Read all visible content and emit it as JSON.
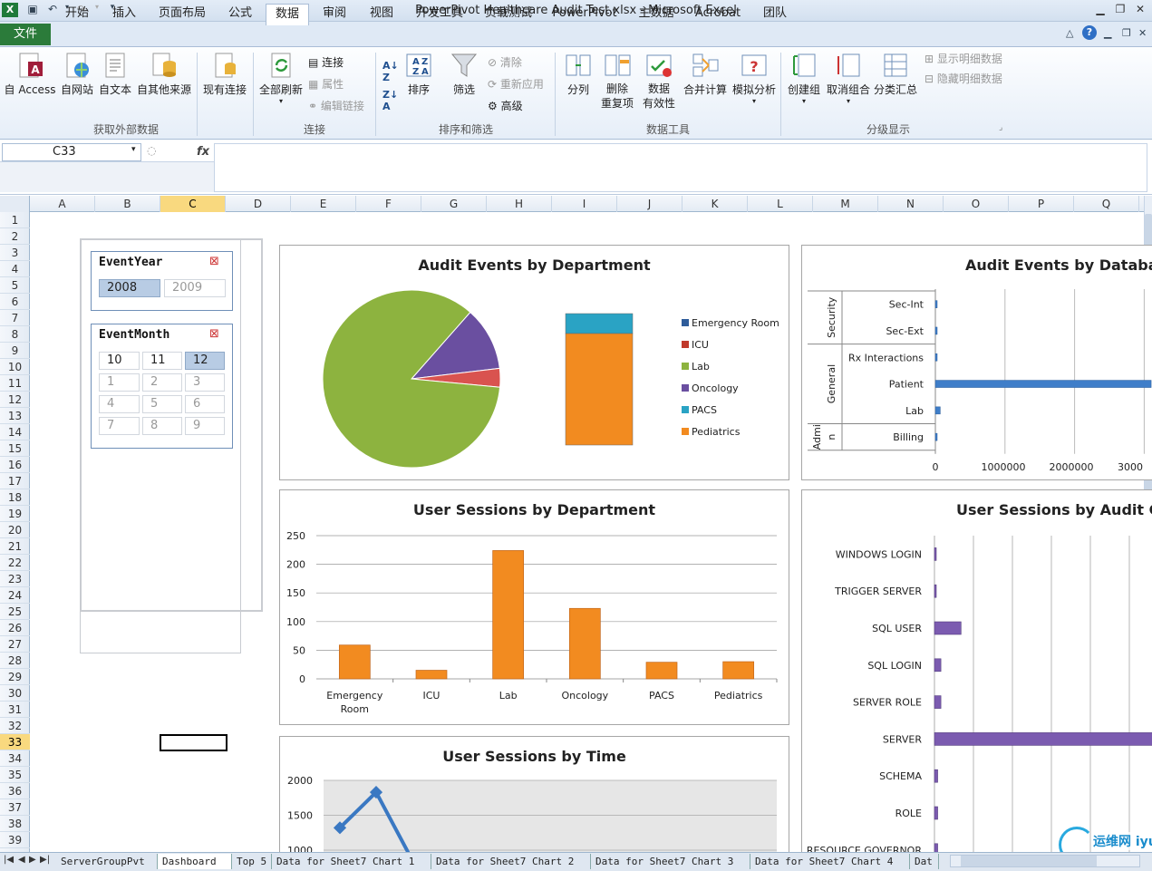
{
  "window": {
    "title": "PowerPivot Healthcare Audit Test.xlsx  -  Microsoft Excel"
  },
  "ribbon": {
    "file_tab": "文件",
    "tabs": [
      "开始",
      "插入",
      "页面布局",
      "公式",
      "数据",
      "审阅",
      "视图",
      "开发工具",
      "负载测试",
      "PowerPivot",
      "主数据",
      "Acrobat",
      "团队"
    ],
    "active_tab": "数据",
    "groups": {
      "external": {
        "label": "获取外部数据",
        "buttons": [
          "自 Access",
          "自网站",
          "自文本",
          "自其他来源",
          "现有连接"
        ]
      },
      "connections": {
        "label": "连接",
        "refresh": "全部刷新",
        "small": [
          "连接",
          "属性",
          "编辑链接"
        ]
      },
      "sort": {
        "label": "排序和筛选",
        "sort": "排序",
        "filter": "筛选",
        "small": [
          "清除",
          "重新应用",
          "高级"
        ]
      },
      "tools": {
        "label": "数据工具",
        "buttons": [
          "分列",
          "删除\n重复项",
          "数据\n有效性",
          "合并计算",
          "模拟分析"
        ],
        "remove_dup": [
          "删除",
          "重复项"
        ],
        "validation": [
          "数据",
          "有效性"
        ]
      },
      "outline": {
        "label": "分级显示",
        "buttons": [
          "创建组",
          "取消组合",
          "分类汇总"
        ],
        "small": [
          "显示明细数据",
          "隐藏明细数据"
        ]
      }
    }
  },
  "formula_bar": {
    "name_box": "C33",
    "fx": "fx",
    "value": ""
  },
  "grid": {
    "columns": [
      "A",
      "B",
      "C",
      "D",
      "E",
      "F",
      "G",
      "H",
      "I",
      "J",
      "K",
      "L",
      "M",
      "N",
      "O",
      "P",
      "Q"
    ],
    "selected_column": "C",
    "rows": [
      "1",
      "2",
      "3",
      "4",
      "5",
      "6",
      "7",
      "8",
      "9",
      "10",
      "11",
      "12",
      "13",
      "14",
      "15",
      "16",
      "17",
      "18",
      "19",
      "20",
      "21",
      "22",
      "23",
      "24",
      "25",
      "26",
      "27",
      "28",
      "29",
      "30",
      "31",
      "32",
      "33",
      "34",
      "35",
      "36",
      "37",
      "38",
      "39"
    ],
    "selected_row": "33"
  },
  "slicers": {
    "year": {
      "title": "EventYear",
      "items": [
        "2008",
        "2009"
      ],
      "selected": "2008"
    },
    "month": {
      "title": "EventMonth",
      "items": [
        "10",
        "11",
        "12",
        "1",
        "2",
        "3",
        "4",
        "5",
        "6",
        "7",
        "8",
        "9"
      ],
      "selected": "12"
    }
  },
  "sheet_tabs": [
    "ServerGroupPvt",
    "Dashboard",
    "Top 5",
    "Data for Sheet7 Chart 1",
    "Data for Sheet7 Chart 2",
    "Data for Sheet7 Chart 3",
    "Data for Sheet7 Chart 4",
    "Dat"
  ],
  "active_sheet": "Dashboard",
  "watermark": "运维网 iyunv.com",
  "chart_data": [
    {
      "type": "pie",
      "title": "Audit Events by Department",
      "legend": [
        "Emergency Room",
        "ICU",
        "Lab",
        "Oncology",
        "PACS",
        "Pediatrics"
      ],
      "colors": [
        "#2e5c9a",
        "#c0392b",
        "#8db33f",
        "#6a4fa0",
        "#2aa3c4",
        "#f28b20"
      ],
      "values": [
        0.2,
        1.2,
        85.0,
        11.6,
        0.4,
        1.6
      ],
      "legend_position": "right"
    },
    {
      "type": "bar",
      "orientation": "horizontal",
      "title": "Audit Events by Database",
      "categories": [
        "Sec-Int",
        "Sec-Ext",
        "Rx Interactions",
        "Patient",
        "Lab",
        "Billing"
      ],
      "groups": [
        {
          "name": "Security",
          "items": [
            "Sec-Int",
            "Sec-Ext"
          ]
        },
        {
          "name": "General",
          "items": [
            "Rx Interactions",
            "Patient",
            "Lab"
          ]
        },
        {
          "name": "Admin",
          "items": [
            "Billing"
          ]
        }
      ],
      "group_labels": [
        "Security",
        "General",
        "Admi\nn"
      ],
      "values": [
        5000,
        5000,
        5000,
        3100000,
        70000,
        5000
      ],
      "x_ticks": [
        "0",
        "1000000",
        "2000000",
        "3000"
      ],
      "xlim": [
        0,
        3000000
      ]
    },
    {
      "type": "bar",
      "title": "User Sessions by Department",
      "categories": [
        "Emergency\nRoom",
        "ICU",
        "Lab",
        "Oncology",
        "PACS",
        "Pediatrics"
      ],
      "category_lines": [
        [
          "Emergency",
          "Room"
        ],
        [
          "ICU"
        ],
        [
          "Lab"
        ],
        [
          "Oncology"
        ],
        [
          "PACS"
        ],
        [
          "Pediatrics"
        ]
      ],
      "values": [
        59,
        15,
        224,
        123,
        29,
        30
      ],
      "ylim": [
        0,
        250
      ],
      "y_ticks": [
        "0",
        "50",
        "100",
        "150",
        "200",
        "250"
      ],
      "y_tick_values": [
        0,
        50,
        100,
        150,
        200,
        250
      ]
    },
    {
      "type": "line",
      "title": "User Sessions by Time",
      "y_ticks": [
        "1000",
        "1500",
        "2000"
      ],
      "y_tick_values": [
        1000,
        1500,
        2000
      ],
      "values": [
        1320,
        1830,
        1000
      ],
      "ylim": [
        1000,
        2000
      ]
    },
    {
      "type": "bar",
      "orientation": "horizontal",
      "title": "User Sessions by Audit Clas",
      "categories": [
        "WINDOWS LOGIN",
        "TRIGGER SERVER",
        "SQL USER",
        "SQL LOGIN",
        "SERVER ROLE",
        "SERVER",
        "SCHEMA",
        "ROLE",
        "RESOURCE GOVERNOR"
      ],
      "values": [
        2,
        1,
        33,
        8,
        8,
        280,
        4,
        4,
        4
      ],
      "xlim": [
        0,
        270
      ]
    }
  ]
}
